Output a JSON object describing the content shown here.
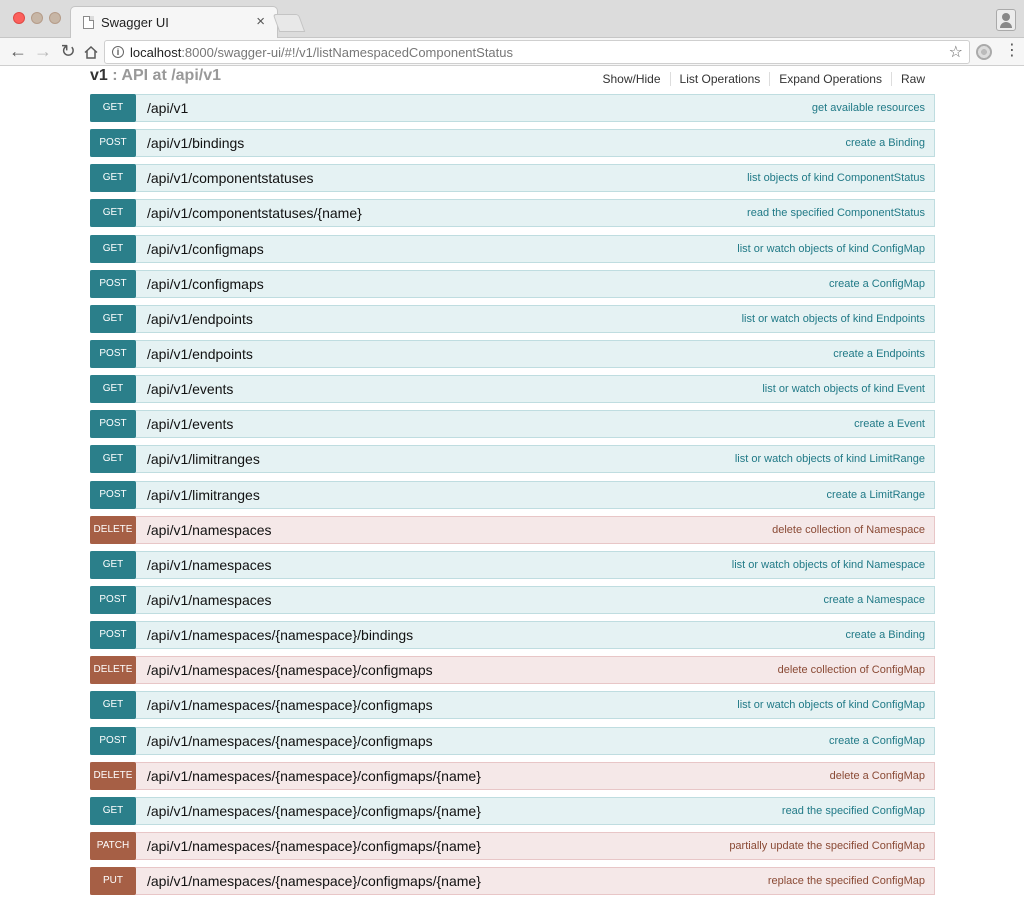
{
  "browser": {
    "tab_title": "Swagger UI",
    "tab_close": "×",
    "url_host": "localhost",
    "url_rest": ":8000/swagger-ui/#!/v1/listNamespacedComponentStatus",
    "icons": [
      "back-icon",
      "forward-icon",
      "reload-icon",
      "home-icon",
      "info-icon",
      "star-icon",
      "extension-icon",
      "menu-icon",
      "profile-icon"
    ]
  },
  "resource": {
    "name": "v1",
    "description": " : API at /api/v1",
    "links": {
      "show_hide": "Show/Hide",
      "list_operations": "List Operations",
      "expand_operations": "Expand Operations",
      "raw": "Raw"
    }
  },
  "operations": [
    {
      "method": "GET",
      "path": "/api/v1",
      "summary": "get available resources"
    },
    {
      "method": "POST",
      "path": "/api/v1/bindings",
      "summary": "create a Binding"
    },
    {
      "method": "GET",
      "path": "/api/v1/componentstatuses",
      "summary": "list objects of kind ComponentStatus"
    },
    {
      "method": "GET",
      "path": "/api/v1/componentstatuses/{name}",
      "summary": "read the specified ComponentStatus"
    },
    {
      "method": "GET",
      "path": "/api/v1/configmaps",
      "summary": "list or watch objects of kind ConfigMap"
    },
    {
      "method": "POST",
      "path": "/api/v1/configmaps",
      "summary": "create a ConfigMap"
    },
    {
      "method": "GET",
      "path": "/api/v1/endpoints",
      "summary": "list or watch objects of kind Endpoints"
    },
    {
      "method": "POST",
      "path": "/api/v1/endpoints",
      "summary": "create a Endpoints"
    },
    {
      "method": "GET",
      "path": "/api/v1/events",
      "summary": "list or watch objects of kind Event"
    },
    {
      "method": "POST",
      "path": "/api/v1/events",
      "summary": "create a Event"
    },
    {
      "method": "GET",
      "path": "/api/v1/limitranges",
      "summary": "list or watch objects of kind LimitRange"
    },
    {
      "method": "POST",
      "path": "/api/v1/limitranges",
      "summary": "create a LimitRange"
    },
    {
      "method": "DELETE",
      "path": "/api/v1/namespaces",
      "summary": "delete collection of Namespace"
    },
    {
      "method": "GET",
      "path": "/api/v1/namespaces",
      "summary": "list or watch objects of kind Namespace"
    },
    {
      "method": "POST",
      "path": "/api/v1/namespaces",
      "summary": "create a Namespace"
    },
    {
      "method": "POST",
      "path": "/api/v1/namespaces/{namespace}/bindings",
      "summary": "create a Binding"
    },
    {
      "method": "DELETE",
      "path": "/api/v1/namespaces/{namespace}/configmaps",
      "summary": "delete collection of ConfigMap"
    },
    {
      "method": "GET",
      "path": "/api/v1/namespaces/{namespace}/configmaps",
      "summary": "list or watch objects of kind ConfigMap"
    },
    {
      "method": "POST",
      "path": "/api/v1/namespaces/{namespace}/configmaps",
      "summary": "create a ConfigMap"
    },
    {
      "method": "DELETE",
      "path": "/api/v1/namespaces/{namespace}/configmaps/{name}",
      "summary": "delete a ConfigMap"
    },
    {
      "method": "GET",
      "path": "/api/v1/namespaces/{namespace}/configmaps/{name}",
      "summary": "read the specified ConfigMap"
    },
    {
      "method": "PATCH",
      "path": "/api/v1/namespaces/{namespace}/configmaps/{name}",
      "summary": "partially update the specified ConfigMap"
    },
    {
      "method": "PUT",
      "path": "/api/v1/namespaces/{namespace}/configmaps/{name}",
      "summary": "replace the specified ConfigMap"
    }
  ],
  "colors": {
    "get_post_method": "#2b7f8a",
    "delete_patch_put_method": "#a65f45",
    "get_post_row": "#e5f2f3",
    "delete_patch_put_row": "#f5e8e8"
  }
}
